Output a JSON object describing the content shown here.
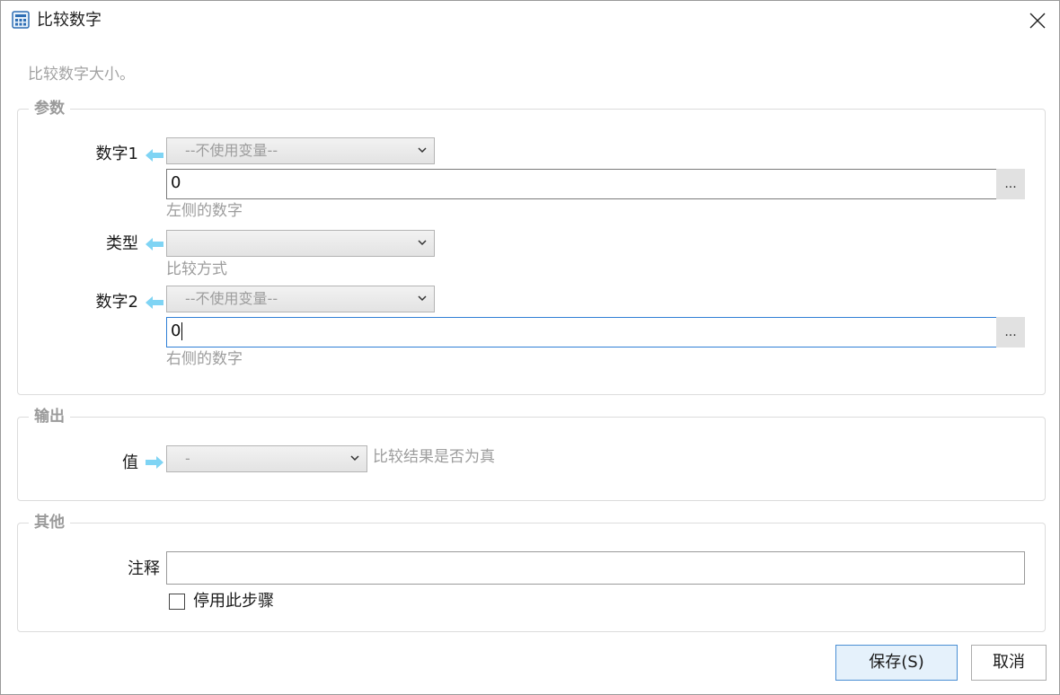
{
  "window": {
    "title": "比较数字",
    "description": "比较数字大小。"
  },
  "icons": {
    "app": "calculator-icon",
    "close": "close-icon",
    "arrow_in": "arrow-left-icon",
    "arrow_out": "arrow-right-icon",
    "chevron": "chevron-down-icon",
    "arrow_color": "#7fd4f4"
  },
  "params": {
    "title": "参数",
    "number1": {
      "label": "数字1",
      "variable": "--不使用变量--",
      "value": "0",
      "dots": "...",
      "hint": "左侧的数字"
    },
    "type": {
      "label": "类型",
      "variable": "",
      "hint": "比较方式"
    },
    "number2": {
      "label": "数字2",
      "variable": "--不使用变量--",
      "value": "0",
      "dots": "...",
      "hint": "右侧的数字"
    }
  },
  "output": {
    "title": "输出",
    "value": {
      "label": "值",
      "variable": "-",
      "hint": "比较结果是否为真"
    }
  },
  "other": {
    "title": "其他",
    "comment": {
      "label": "注释",
      "value": ""
    },
    "disable": {
      "label": "停用此步骤",
      "checked": false
    }
  },
  "buttons": {
    "save": "保存(S)",
    "cancel": "取消"
  },
  "colors": {
    "accent": "#2f7fd6",
    "primary_button_bg": "#e5f1fb"
  }
}
